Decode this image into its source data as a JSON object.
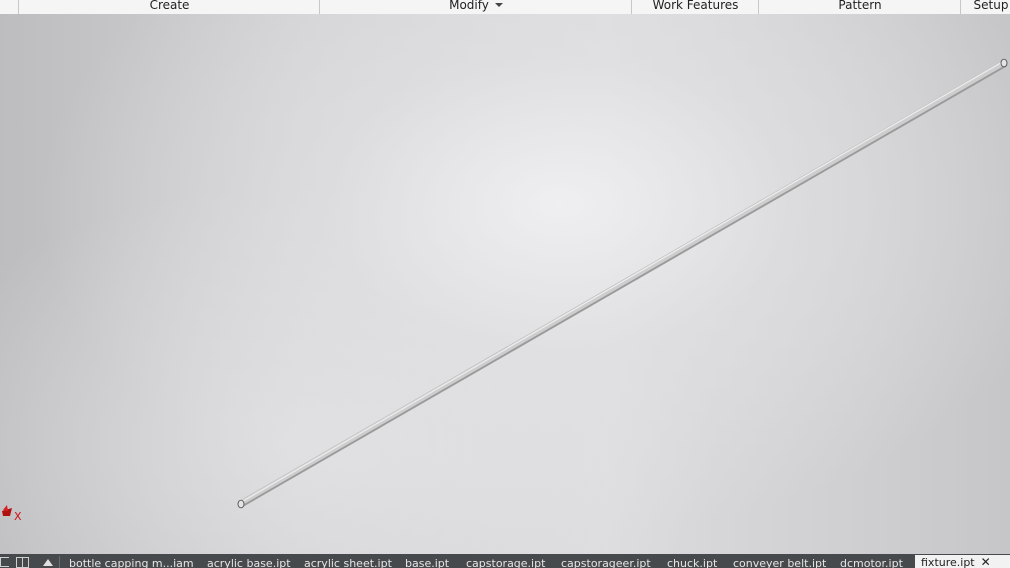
{
  "ribbon": {
    "panels": [
      {
        "label": "Create"
      },
      {
        "label": "Modify",
        "has_dropdown": true
      },
      {
        "label": "Work Features"
      },
      {
        "label": "Pattern"
      },
      {
        "label": "Setup"
      }
    ]
  },
  "viewport": {
    "model": "cylindrical rod",
    "triad": {
      "x_label": "X",
      "x_color": "#cc1111"
    }
  },
  "tabbar": {
    "icons": [
      "document-list-icon",
      "tile-views-icon",
      "scroll-up-icon"
    ],
    "tabs": [
      {
        "label": "bottle capping m...iam"
      },
      {
        "label": "acrylic base.ipt"
      },
      {
        "label": "acrylic sheet.ipt"
      },
      {
        "label": "base.ipt"
      },
      {
        "label": "capstorage.ipt"
      },
      {
        "label": "capstorageer.ipt"
      },
      {
        "label": "chuck.ipt"
      },
      {
        "label": "conveyer belt.ipt"
      },
      {
        "label": "dcmotor.ipt"
      },
      {
        "label": "fixture.ipt",
        "active": true,
        "close": "✕"
      }
    ]
  }
}
